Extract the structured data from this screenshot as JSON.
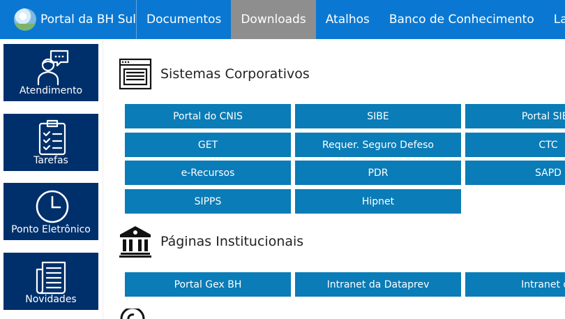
{
  "header": {
    "brand": "Portal da BH Sul",
    "nav": [
      {
        "label": "Documentos",
        "active": false
      },
      {
        "label": "Downloads",
        "active": true
      },
      {
        "label": "Atalhos",
        "active": false
      },
      {
        "label": "Banco de Conhecimento",
        "active": false
      },
      {
        "label": "Labs",
        "active": false
      }
    ]
  },
  "sidebar": {
    "items": [
      {
        "label": "Atendimento",
        "icon": "attendant-icon"
      },
      {
        "label": "Tarefas",
        "icon": "clipboard-checklist-icon"
      },
      {
        "label": "Ponto Eletrônico",
        "icon": "clock-icon"
      },
      {
        "label": "Novidades",
        "icon": "newspaper-icon"
      }
    ]
  },
  "sections": {
    "corporativos": {
      "title": "Sistemas Corporativos",
      "icon": "window-icon",
      "buttons": [
        "Portal do CNIS",
        "SIBE",
        "Portal SIBE",
        "GET",
        "Requer. Seguro Defeso",
        "CTC",
        "e-Recursos",
        "PDR",
        "SAPD",
        "SIPPS",
        "Hipnet"
      ]
    },
    "institucionais": {
      "title": "Páginas Institucionais",
      "icon": "institution-icon",
      "buttons": [
        "Portal Gex BH",
        "Intranet da Dataprev",
        "Intranet do"
      ]
    }
  },
  "colors": {
    "topbar": "#0a78d2",
    "nav_active": "#8e8e8e",
    "sidebar_tile": "#00306b",
    "link_button": "#0a7cb7"
  }
}
